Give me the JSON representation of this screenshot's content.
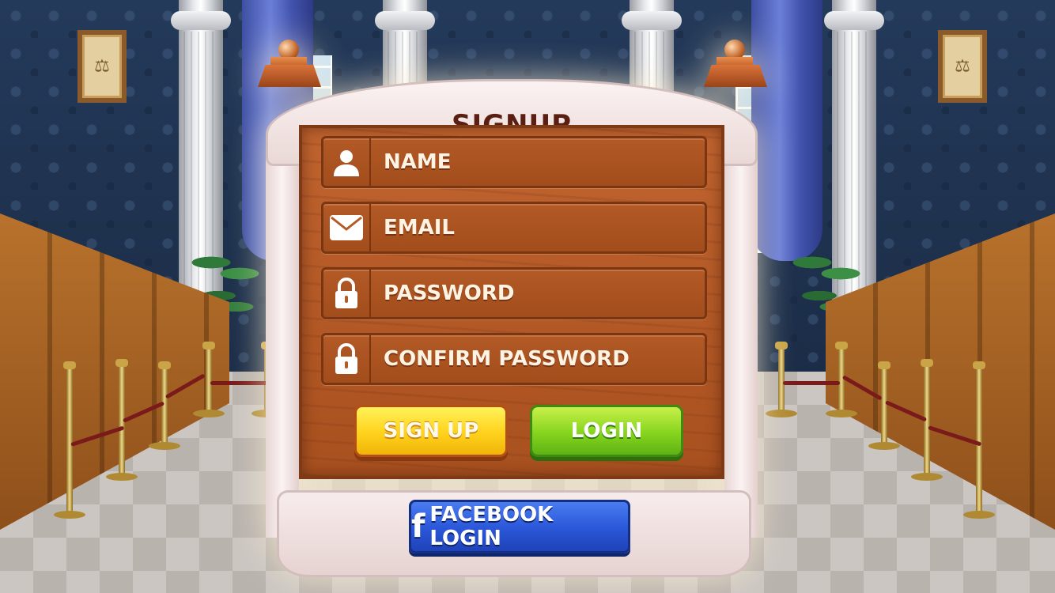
{
  "screen": {
    "title": "SIGNUP"
  },
  "form": {
    "fields": [
      {
        "label": "NAME",
        "icon": "user-icon"
      },
      {
        "label": "EMAIL",
        "icon": "envelope-icon"
      },
      {
        "label": "PASSWORD",
        "icon": "lock-icon"
      },
      {
        "label": "CONFIRM PASSWORD",
        "icon": "lock-icon"
      }
    ]
  },
  "buttons": {
    "signup_label": "SIGN UP",
    "login_label": "LOGIN",
    "facebook_label": "FACEBOOK LOGIN",
    "facebook_icon": "facebook-icon"
  },
  "colors": {
    "title": "#5a1f12",
    "signup_button": "#ffd21c",
    "login_button": "#86d41e",
    "facebook_button": "#2a56d8",
    "panel_wood": "#b35a26"
  }
}
